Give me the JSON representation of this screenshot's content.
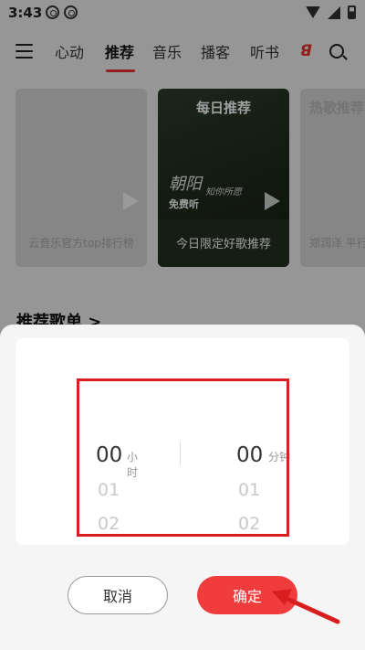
{
  "status_bar": {
    "time": "3:43"
  },
  "nav": {
    "tabs": [
      "心动",
      "推荐",
      "音乐",
      "播客",
      "听书"
    ],
    "active_tab": "推荐"
  },
  "cards": [
    {
      "header": "",
      "caption": "云音乐官方top排行榜"
    },
    {
      "header": "每日推荐",
      "script": "朝阳",
      "script2": "知你所愿",
      "free_tag": "免费听",
      "caption": "今日限定好歌推荐"
    },
    {
      "header": "热歌推荐",
      "caption": "郑润泽 平行"
    }
  ],
  "section": {
    "title": "推荐歌单 >"
  },
  "picker": {
    "hours": {
      "selected": "00",
      "unit": "小时",
      "next": [
        "01",
        "02"
      ]
    },
    "minutes": {
      "selected": "00",
      "unit": "分钟",
      "next": [
        "01",
        "02"
      ]
    }
  },
  "buttons": {
    "cancel": "取消",
    "confirm": "确定"
  },
  "colors": {
    "accent": "#f03c3c",
    "annotation": "#d81e1e"
  }
}
